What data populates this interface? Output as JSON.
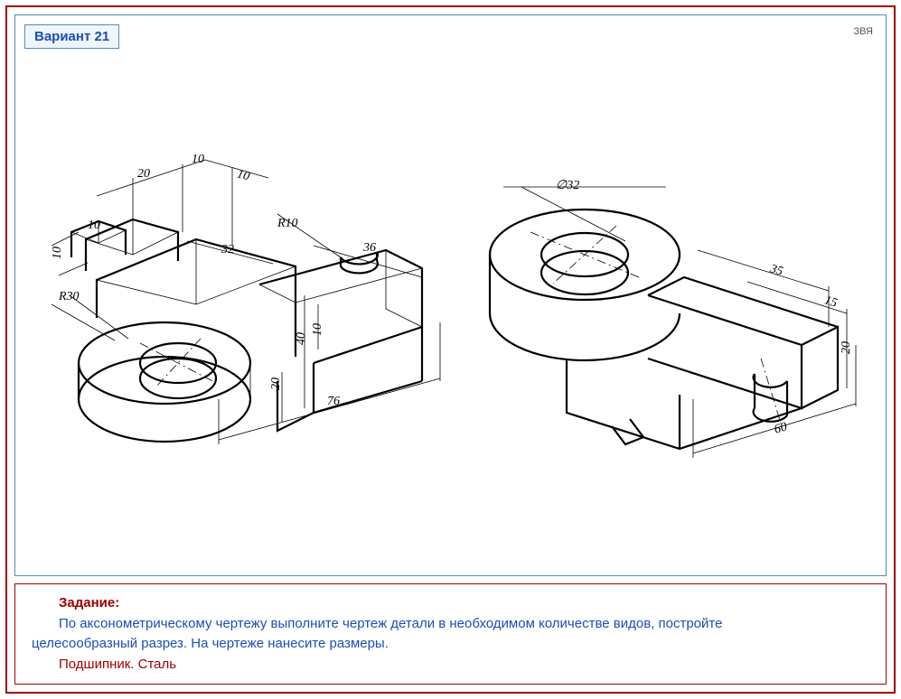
{
  "variant_label": "Вариант 21",
  "watermark": "ЗВЯ",
  "task": {
    "title": "Задание:",
    "body_line1_indent": "По аксонометрическому чертежу выполните чертеж детали в необходимом количестве видов, постройте",
    "body_line2": "целесообразный разрез. На чертеже нанесите размеры.",
    "part_material": "Подшипник.  Сталь"
  },
  "left_drawing": {
    "dimensions": {
      "d20_top": "20",
      "d10_top": "10",
      "d10_diag": "10",
      "d10_left": "10",
      "d10_left2": "10",
      "r10": "R10",
      "d32": "32",
      "d36": "36",
      "r30": "R30",
      "d40": "40",
      "d10_mid": "10",
      "d20_bottom": "20",
      "d76": "76"
    }
  },
  "right_drawing": {
    "dimensions": {
      "phi32": "∅32",
      "d35": "35",
      "d15": "15",
      "d20": "20",
      "d60": "60"
    }
  }
}
